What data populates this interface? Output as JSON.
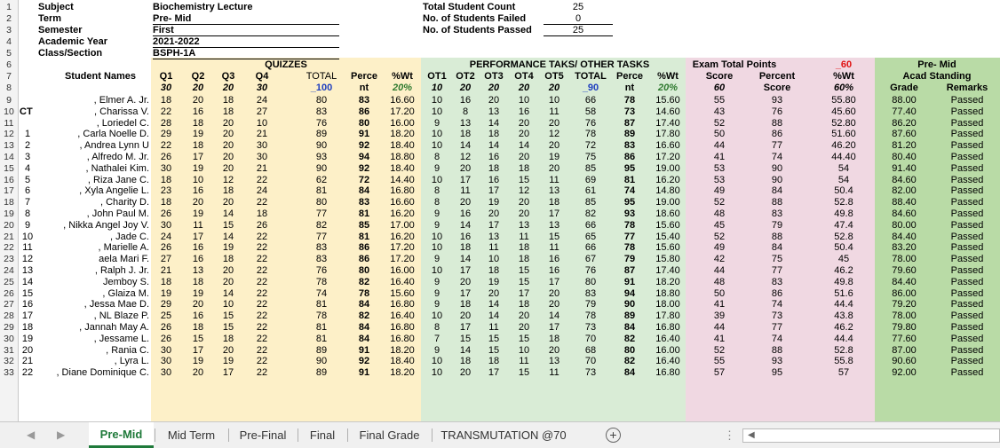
{
  "info": {
    "subject_label": "Subject",
    "subject": "Biochemistry Lecture",
    "term_label": "Term",
    "term": "Pre- Mid",
    "semester_label": "Semester",
    "semester": "First",
    "year_label": "Academic Year",
    "year": "2021-2022",
    "class_label": "Class/Section",
    "class": "BSPH-1A",
    "total_label": "Total Student Count",
    "total": "25",
    "failed_label": "No. of Students Failed",
    "failed": "0",
    "passed_label": "No. of Students Passed",
    "passed": "25"
  },
  "headers": {
    "student_names": "Student Names",
    "quizzes": "QUIZZES",
    "perf": "PERFORMANCE TAKS/ OTHER TASKS",
    "exam": "Exam Total Points",
    "exam_max": "_60",
    "standing1": "Pre- Mid",
    "standing2": "Acad Standing",
    "q1": "Q1",
    "q2": "Q2",
    "q3": "Q3",
    "q4": "Q4",
    "qtotal": "TOTAL",
    "perce": "Perce",
    "nt": "nt",
    "pwt": "%Wt",
    "ot1": "OT1",
    "ot2": "OT2",
    "ot3": "OT3",
    "ot4": "OT4",
    "ot5": "OT5",
    "ototal": "TOTAL",
    "score": "Score",
    "percent": "Percent",
    "score2": "Score",
    "grade": "Grade",
    "remarks": "Remarks",
    "q1max": "30",
    "q2max": "20",
    "q3max": "20",
    "q4max": "30",
    "qtotmax": "_100",
    "qwt": "20%",
    "ot1max": "10",
    "ot2max": "20",
    "ot3max": "20",
    "ot4max": "20",
    "ot5max": "20",
    "ototmax": "_90",
    "owt": "20%",
    "emax": "60",
    "ewt": "60%",
    "ct": "CT"
  },
  "rows": [
    {
      "n": "",
      "name": ", Elmer A. Jr.",
      "q": [
        "18",
        "20",
        "18",
        "24"
      ],
      "qt": "80",
      "qp": "83",
      "qw": "16.60",
      "o": [
        "10",
        "16",
        "20",
        "10",
        "10"
      ],
      "ot": "66",
      "op": "78",
      "ow": "15.60",
      "es": "55",
      "ep": "93",
      "ew": "55.80",
      "g": "88.00",
      "r": "Passed"
    },
    {
      "n": "",
      "name": ", Charissa V.",
      "q": [
        "22",
        "16",
        "18",
        "27"
      ],
      "qt": "83",
      "qp": "86",
      "qw": "17.20",
      "o": [
        "10",
        "8",
        "13",
        "16",
        "11"
      ],
      "ot": "58",
      "op": "73",
      "ow": "14.60",
      "es": "43",
      "ep": "76",
      "ew": "45.60",
      "g": "77.40",
      "r": "Passed"
    },
    {
      "n": "",
      "name": ", Loriedel C.",
      "q": [
        "28",
        "18",
        "20",
        "10"
      ],
      "qt": "76",
      "qp": "80",
      "qw": "16.00",
      "o": [
        "9",
        "13",
        "14",
        "20",
        "20"
      ],
      "ot": "76",
      "op": "87",
      "ow": "17.40",
      "es": "52",
      "ep": "88",
      "ew": "52.80",
      "g": "86.20",
      "r": "Passed"
    },
    {
      "n": "1",
      "name": ", Carla Noelle D.",
      "q": [
        "29",
        "19",
        "20",
        "21"
      ],
      "qt": "89",
      "qp": "91",
      "qw": "18.20",
      "o": [
        "10",
        "18",
        "18",
        "20",
        "12"
      ],
      "ot": "78",
      "op": "89",
      "ow": "17.80",
      "es": "50",
      "ep": "86",
      "ew": "51.60",
      "g": "87.60",
      "r": "Passed"
    },
    {
      "n": "2",
      "name": ", Andrea Lynn U",
      "q": [
        "22",
        "18",
        "20",
        "30"
      ],
      "qt": "90",
      "qp": "92",
      "qw": "18.40",
      "o": [
        "10",
        "14",
        "14",
        "14",
        "20"
      ],
      "ot": "72",
      "op": "83",
      "ow": "16.60",
      "es": "44",
      "ep": "77",
      "ew": "46.20",
      "g": "81.20",
      "r": "Passed"
    },
    {
      "n": "3",
      "name": ", Alfredo M. Jr.",
      "q": [
        "26",
        "17",
        "20",
        "30"
      ],
      "qt": "93",
      "qp": "94",
      "qw": "18.80",
      "o": [
        "8",
        "12",
        "16",
        "20",
        "19"
      ],
      "ot": "75",
      "op": "86",
      "ow": "17.20",
      "es": "41",
      "ep": "74",
      "ew": "44.40",
      "g": "80.40",
      "r": "Passed"
    },
    {
      "n": "4",
      "name": ", Nathalei Kim.",
      "q": [
        "30",
        "19",
        "20",
        "21"
      ],
      "qt": "90",
      "qp": "92",
      "qw": "18.40",
      "o": [
        "9",
        "20",
        "18",
        "18",
        "20"
      ],
      "ot": "85",
      "op": "95",
      "ow": "19.00",
      "es": "53",
      "ep": "90",
      "ew": "54",
      "g": "91.40",
      "r": "Passed"
    },
    {
      "n": "5",
      "name": ", Riza Jane C.",
      "q": [
        "18",
        "10",
        "12",
        "22"
      ],
      "qt": "62",
      "qp": "72",
      "qw": "14.40",
      "o": [
        "10",
        "17",
        "16",
        "15",
        "11"
      ],
      "ot": "69",
      "op": "81",
      "ow": "16.20",
      "es": "53",
      "ep": "90",
      "ew": "54",
      "g": "84.60",
      "r": "Passed"
    },
    {
      "n": "6",
      "name": ", Xyla Angelie L.",
      "q": [
        "23",
        "16",
        "18",
        "24"
      ],
      "qt": "81",
      "qp": "84",
      "qw": "16.80",
      "o": [
        "8",
        "11",
        "17",
        "12",
        "13"
      ],
      "ot": "61",
      "op": "74",
      "ow": "14.80",
      "es": "49",
      "ep": "84",
      "ew": "50.4",
      "g": "82.00",
      "r": "Passed"
    },
    {
      "n": "7",
      "name": ", Charity D.",
      "q": [
        "18",
        "20",
        "20",
        "22"
      ],
      "qt": "80",
      "qp": "83",
      "qw": "16.60",
      "o": [
        "8",
        "20",
        "19",
        "20",
        "18"
      ],
      "ot": "85",
      "op": "95",
      "ow": "19.00",
      "es": "52",
      "ep": "88",
      "ew": "52.8",
      "g": "88.40",
      "r": "Passed"
    },
    {
      "n": "8",
      "name": ", John Paul M.",
      "q": [
        "26",
        "19",
        "14",
        "18"
      ],
      "qt": "77",
      "qp": "81",
      "qw": "16.20",
      "o": [
        "9",
        "16",
        "20",
        "20",
        "17"
      ],
      "ot": "82",
      "op": "93",
      "ow": "18.60",
      "es": "48",
      "ep": "83",
      "ew": "49.8",
      "g": "84.60",
      "r": "Passed"
    },
    {
      "n": "9",
      "name": ", Nikka Angel Joy V.",
      "q": [
        "30",
        "11",
        "15",
        "26"
      ],
      "qt": "82",
      "qp": "85",
      "qw": "17.00",
      "o": [
        "9",
        "14",
        "17",
        "13",
        "13"
      ],
      "ot": "66",
      "op": "78",
      "ow": "15.60",
      "es": "45",
      "ep": "79",
      "ew": "47.4",
      "g": "80.00",
      "r": "Passed"
    },
    {
      "n": "10",
      "name": ", Jade C.",
      "q": [
        "24",
        "17",
        "14",
        "22"
      ],
      "qt": "77",
      "qp": "81",
      "qw": "16.20",
      "o": [
        "10",
        "16",
        "13",
        "11",
        "15"
      ],
      "ot": "65",
      "op": "77",
      "ow": "15.40",
      "es": "52",
      "ep": "88",
      "ew": "52.8",
      "g": "84.40",
      "r": "Passed"
    },
    {
      "n": "11",
      "name": ", Marielle A.",
      "q": [
        "26",
        "16",
        "19",
        "22"
      ],
      "qt": "83",
      "qp": "86",
      "qw": "17.20",
      "o": [
        "10",
        "18",
        "11",
        "18",
        "11"
      ],
      "ot": "66",
      "op": "78",
      "ow": "15.60",
      "es": "49",
      "ep": "84",
      "ew": "50.4",
      "g": "83.20",
      "r": "Passed"
    },
    {
      "n": "12",
      "name": "aela Mari F.",
      "q": [
        "27",
        "16",
        "18",
        "22"
      ],
      "qt": "83",
      "qp": "86",
      "qw": "17.20",
      "o": [
        "9",
        "14",
        "10",
        "18",
        "16"
      ],
      "ot": "67",
      "op": "79",
      "ow": "15.80",
      "es": "42",
      "ep": "75",
      "ew": "45",
      "g": "78.00",
      "r": "Passed"
    },
    {
      "n": "13",
      "name": ", Ralph J. Jr.",
      "q": [
        "21",
        "13",
        "20",
        "22"
      ],
      "qt": "76",
      "qp": "80",
      "qw": "16.00",
      "o": [
        "10",
        "17",
        "18",
        "15",
        "16"
      ],
      "ot": "76",
      "op": "87",
      "ow": "17.40",
      "es": "44",
      "ep": "77",
      "ew": "46.2",
      "g": "79.60",
      "r": "Passed"
    },
    {
      "n": "14",
      "name": "Jemboy S.",
      "q": [
        "18",
        "18",
        "20",
        "22"
      ],
      "qt": "78",
      "qp": "82",
      "qw": "16.40",
      "o": [
        "9",
        "20",
        "19",
        "15",
        "17"
      ],
      "ot": "80",
      "op": "91",
      "ow": "18.20",
      "es": "48",
      "ep": "83",
      "ew": "49.8",
      "g": "84.40",
      "r": "Passed"
    },
    {
      "n": "15",
      "name": ", Glaiza M.",
      "q": [
        "19",
        "19",
        "14",
        "22"
      ],
      "qt": "74",
      "qp": "78",
      "qw": "15.60",
      "o": [
        "9",
        "17",
        "20",
        "17",
        "20"
      ],
      "ot": "83",
      "op": "94",
      "ow": "18.80",
      "es": "50",
      "ep": "86",
      "ew": "51.6",
      "g": "86.00",
      "r": "Passed"
    },
    {
      "n": "16",
      "name": ", Jessa Mae D.",
      "q": [
        "29",
        "20",
        "10",
        "22"
      ],
      "qt": "81",
      "qp": "84",
      "qw": "16.80",
      "o": [
        "9",
        "18",
        "14",
        "18",
        "20"
      ],
      "ot": "79",
      "op": "90",
      "ow": "18.00",
      "es": "41",
      "ep": "74",
      "ew": "44.4",
      "g": "79.20",
      "r": "Passed"
    },
    {
      "n": "17",
      "name": ", NL Blaze P.",
      "q": [
        "25",
        "16",
        "15",
        "22"
      ],
      "qt": "78",
      "qp": "82",
      "qw": "16.40",
      "o": [
        "10",
        "20",
        "14",
        "20",
        "14"
      ],
      "ot": "78",
      "op": "89",
      "ow": "17.80",
      "es": "39",
      "ep": "73",
      "ew": "43.8",
      "g": "78.00",
      "r": "Passed"
    },
    {
      "n": "18",
      "name": ", Jannah May A.",
      "q": [
        "26",
        "18",
        "15",
        "22"
      ],
      "qt": "81",
      "qp": "84",
      "qw": "16.80",
      "o": [
        "8",
        "17",
        "11",
        "20",
        "17"
      ],
      "ot": "73",
      "op": "84",
      "ow": "16.80",
      "es": "44",
      "ep": "77",
      "ew": "46.2",
      "g": "79.80",
      "r": "Passed"
    },
    {
      "n": "19",
      "name": ", Jessame L.",
      "q": [
        "26",
        "15",
        "18",
        "22"
      ],
      "qt": "81",
      "qp": "84",
      "qw": "16.80",
      "o": [
        "7",
        "15",
        "15",
        "15",
        "18"
      ],
      "ot": "70",
      "op": "82",
      "ow": "16.40",
      "es": "41",
      "ep": "74",
      "ew": "44.4",
      "g": "77.60",
      "r": "Passed"
    },
    {
      "n": "20",
      "name": ", Rania C.",
      "q": [
        "30",
        "17",
        "20",
        "22"
      ],
      "qt": "89",
      "qp": "91",
      "qw": "18.20",
      "o": [
        "9",
        "14",
        "15",
        "10",
        "20"
      ],
      "ot": "68",
      "op": "80",
      "ow": "16.00",
      "es": "52",
      "ep": "88",
      "ew": "52.8",
      "g": "87.00",
      "r": "Passed"
    },
    {
      "n": "21",
      "name": ", Lyra L.",
      "q": [
        "30",
        "19",
        "19",
        "22"
      ],
      "qt": "90",
      "qp": "92",
      "qw": "18.40",
      "o": [
        "10",
        "18",
        "18",
        "11",
        "13"
      ],
      "ot": "70",
      "op": "82",
      "ow": "16.40",
      "es": "55",
      "ep": "93",
      "ew": "55.8",
      "g": "90.60",
      "r": "Passed"
    },
    {
      "n": "22",
      "name": ", Diane Dominique C.",
      "q": [
        "30",
        "20",
        "17",
        "22"
      ],
      "qt": "89",
      "qp": "91",
      "qw": "18.20",
      "o": [
        "10",
        "20",
        "17",
        "15",
        "11"
      ],
      "ot": "73",
      "op": "84",
      "ow": "16.80",
      "es": "57",
      "ep": "95",
      "ew": "57",
      "g": "92.00",
      "r": "Passed"
    }
  ],
  "tabs": [
    "Pre-Mid",
    "Mid Term",
    "Pre-Final",
    "Final",
    "Final Grade",
    "TRANSMUTATION @70"
  ],
  "colors": {
    "quiz_bg": "#fdf0c8",
    "perf_bg": "#d9ecd6",
    "exam_bg": "#f0d8e2",
    "standing_bg": "#b9dba6",
    "accent": "#1f7a3a"
  }
}
